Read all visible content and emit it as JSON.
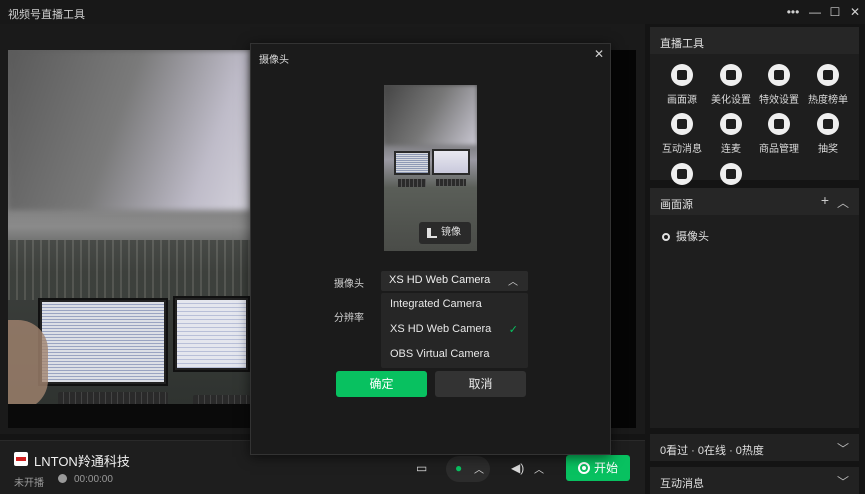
{
  "window": {
    "title": "视频号直播工具",
    "more_icon": "more-horizontal-icon",
    "minimize_icon": "minimize-icon",
    "maximize_icon": "maximize-icon",
    "close_icon": "close-icon"
  },
  "bottom_bar": {
    "brand": "LNTON羚通科技",
    "status": "未开播",
    "timer": "00:00:00",
    "start_label": "开始"
  },
  "live_tools": {
    "title": "直播工具",
    "items": [
      {
        "label": "画面源",
        "icon": "screen-source-icon"
      },
      {
        "label": "美化设置",
        "icon": "beauty-icon"
      },
      {
        "label": "特效设置",
        "icon": "effects-icon"
      },
      {
        "label": "热度榜单",
        "icon": "list-icon"
      },
      {
        "label": "互动消息",
        "icon": "message-icon"
      },
      {
        "label": "连麦",
        "icon": "call-icon"
      },
      {
        "label": "商品管理",
        "icon": "shop-bag-icon"
      },
      {
        "label": "抽奖",
        "icon": "lottery-icon"
      },
      {
        "label": "",
        "icon": "heart-icon"
      },
      {
        "label": "",
        "icon": "wand-icon"
      }
    ]
  },
  "sources": {
    "title": "画面源",
    "item": "摄像头"
  },
  "stats": {
    "text": "0看过 · 0在线 · 0热度"
  },
  "messages": {
    "title": "互动消息"
  },
  "dialog": {
    "title": "摄像头",
    "mirror_label": "镜像",
    "camera_label": "摄像头",
    "resolution_label": "分辨率",
    "selected_camera": "XS HD Web Camera",
    "options": [
      "Integrated Camera",
      "XS HD Web Camera",
      "OBS Virtual Camera"
    ],
    "confirm_label": "确定",
    "cancel_label": "取消"
  }
}
